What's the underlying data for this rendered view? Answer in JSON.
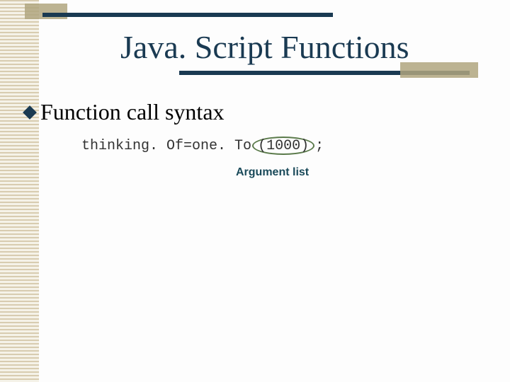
{
  "title": "Java. Script Functions",
  "bullet": "Function call syntax",
  "code": {
    "lhs": "thinking. Of",
    "eq": " = ",
    "fn": "one. To",
    "args": "(1000)",
    "semi": " ;"
  },
  "annotation": "Argument list"
}
